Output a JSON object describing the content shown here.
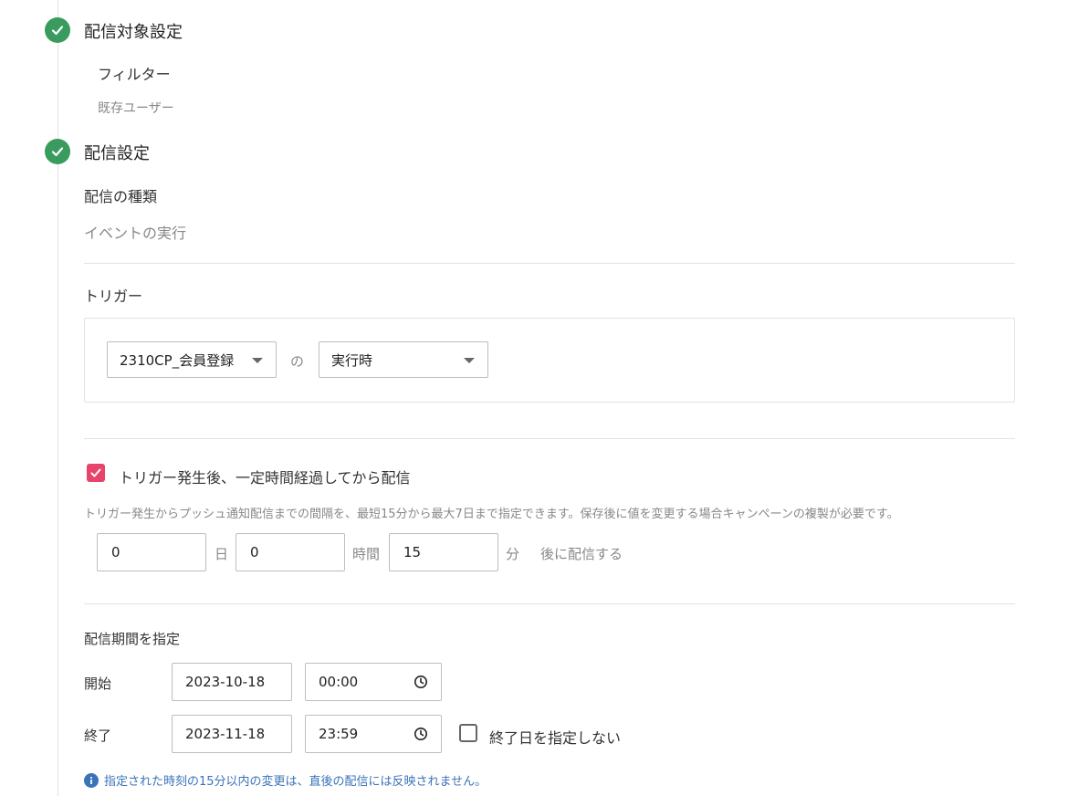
{
  "colors": {
    "success": "#3a9b5e",
    "checkbox_checked": "#e8446b",
    "info_text": "#3b73b9",
    "info_icon": "#3b73b9"
  },
  "steps": [
    {
      "title": "配信対象設定",
      "icon": "check-icon",
      "filter_label": "フィルター",
      "filter_value": "既存ユーザー"
    },
    {
      "title": "配信設定",
      "icon": "check-icon",
      "type_label": "配信の種類",
      "type_value": "イベントの実行"
    }
  ],
  "trigger": {
    "label": "トリガー",
    "event_select": "2310CP_会員登録",
    "connector": "の",
    "timing_select": "実行時"
  },
  "delay": {
    "checkbox_label": "トリガー発生後、一定時間経過してから配信",
    "checked": true,
    "help": "トリガー発生からプッシュ通知配信までの間隔を、最短15分から最大7日まで指定できます。保存後に値を変更する場合キャンペーンの複製が必要です。",
    "days_value": "0",
    "days_unit": "日",
    "hours_value": "0",
    "hours_unit": "時間",
    "minutes_value": "15",
    "minutes_unit": "分",
    "suffix": "後に配信する"
  },
  "period": {
    "label": "配信期間を指定",
    "start_label": "開始",
    "start_date": "2023-10-18",
    "start_time": "00:00",
    "end_label": "終了",
    "end_date": "2023-11-18",
    "end_time": "23:59",
    "no_end_label": "終了日を指定しない",
    "no_end_checked": false,
    "info": "指定された時刻の15分以内の変更は、直後の配信には反映されません。"
  }
}
